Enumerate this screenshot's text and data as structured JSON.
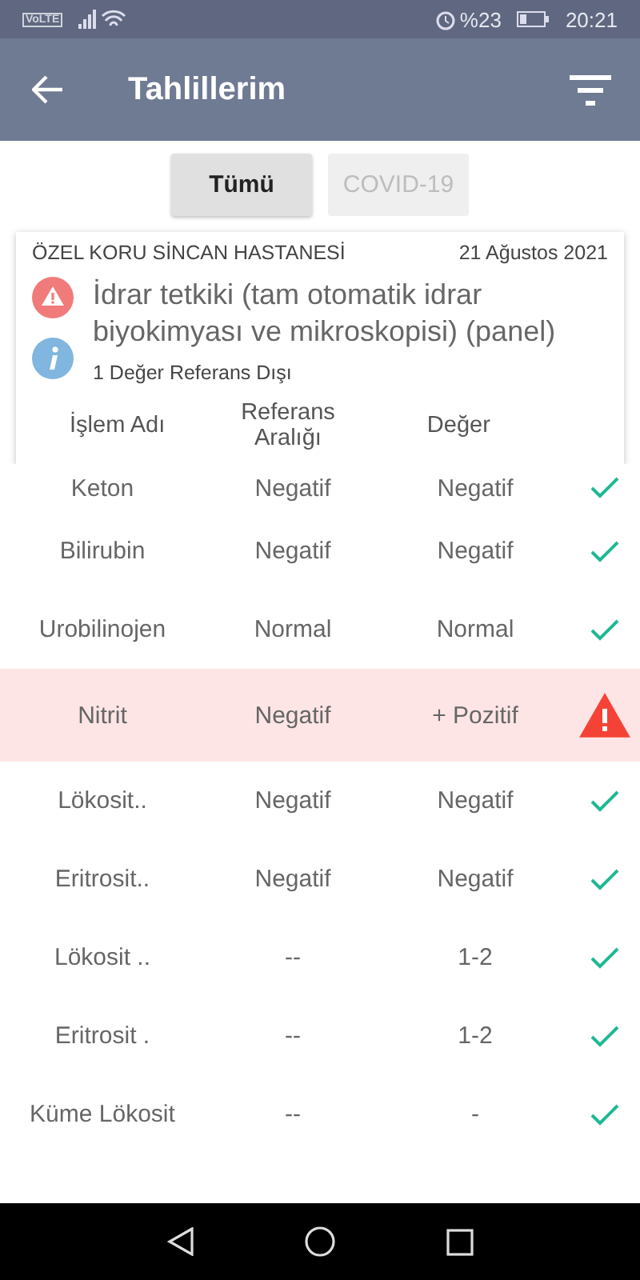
{
  "status_bar": {
    "network": "VoLTE",
    "battery": "%23",
    "time": "20:21"
  },
  "app_bar": {
    "title": "Tahlillerim"
  },
  "tabs": [
    {
      "label": "Tümü",
      "selected": true
    },
    {
      "label": "COVID-19",
      "selected": false
    }
  ],
  "card": {
    "hospital": "ÖZEL KORU SİNCAN HASTANESİ",
    "date": "21 Ağustos 2021",
    "test_name": "İdrar tetkiki (tam otomatik idrar biyokimyası ve mikroskopisi) (panel)",
    "summary": "1 Değer Referans Dışı",
    "columns": [
      "İşlem Adı",
      "Referans Aralığı",
      "Değer"
    ]
  },
  "rows": [
    {
      "name": "Keton",
      "reference": "Negatif",
      "value": "Negatif",
      "out_of_range": false
    },
    {
      "name": "Bilirubin",
      "reference": "Negatif",
      "value": "Negatif",
      "out_of_range": false
    },
    {
      "name": "Urobilinojen",
      "reference": "Normal",
      "value": "Normal",
      "out_of_range": false
    },
    {
      "name": "Nitrit",
      "reference": "Negatif",
      "value": "+ Pozitif",
      "out_of_range": true
    },
    {
      "name": "Lökosit..",
      "reference": "Negatif",
      "value": "Negatif",
      "out_of_range": false
    },
    {
      "name": "Eritrosit..",
      "reference": "Negatif",
      "value": "Negatif",
      "out_of_range": false
    },
    {
      "name": "Lökosit ..",
      "reference": "--",
      "value": "1-2",
      "out_of_range": false
    },
    {
      "name": "Eritrosit .",
      "reference": "--",
      "value": "1-2",
      "out_of_range": false
    },
    {
      "name": "Küme Lökosit",
      "reference": "--",
      "value": "-",
      "out_of_range": false
    }
  ]
}
